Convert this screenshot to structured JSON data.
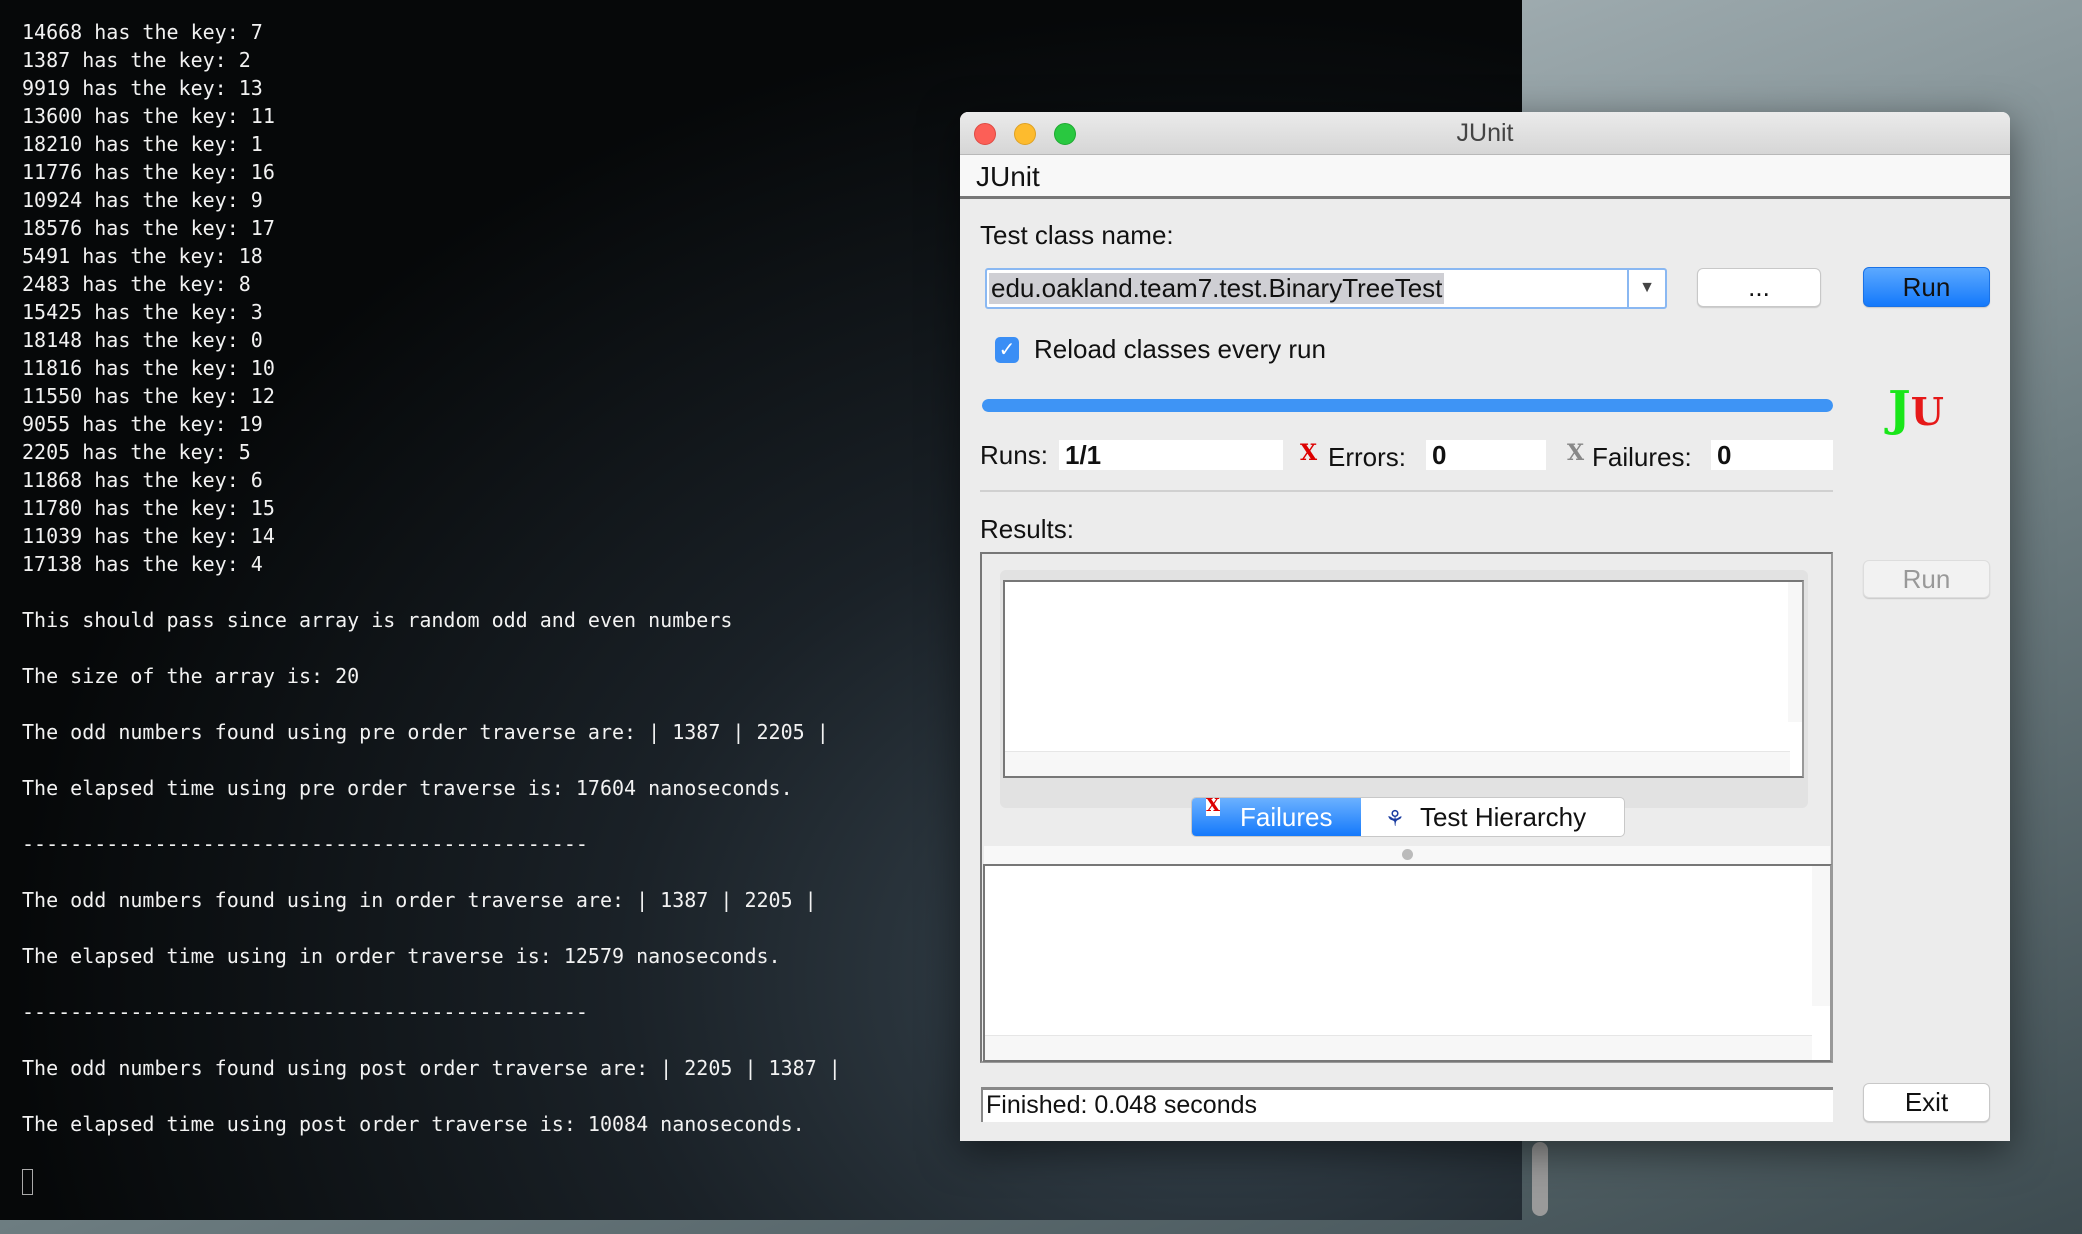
{
  "terminal": {
    "lines": [
      "14668 has the key: 7",
      "1387 has the key: 2",
      "9919 has the key: 13",
      "13600 has the key: 11",
      "18210 has the key: 1",
      "11776 has the key: 16",
      "10924 has the key: 9",
      "18576 has the key: 17",
      "5491 has the key: 18",
      "2483 has the key: 8",
      "15425 has the key: 3",
      "18148 has the key: 0",
      "11816 has the key: 10",
      "11550 has the key: 12",
      "9055 has the key: 19",
      "2205 has the key: 5",
      "11868 has the key: 6",
      "11780 has the key: 15",
      "11039 has the key: 14",
      "17138 has the key: 4",
      "",
      "This should pass since array is random odd and even numbers",
      "",
      "The size of the array is: 20",
      "",
      "The odd numbers found using pre order traverse are: | 1387 | 2205 |",
      "",
      "The elapsed time using pre order traverse is: 17604 nanoseconds.",
      "",
      "-----------------------------------------------",
      "",
      "The odd numbers found using in order traverse are: | 1387 | 2205 |",
      "",
      "The elapsed time using in order traverse is: 12579 nanoseconds.",
      "",
      "-----------------------------------------------",
      "",
      "The odd numbers found using post order traverse are: | 2205 | 1387 |",
      "",
      "The elapsed time using post order traverse is: 10084 nanoseconds.",
      ""
    ]
  },
  "window": {
    "title": "JUnit",
    "menu": "JUnit"
  },
  "form": {
    "test_class_label": "Test class name:",
    "test_class_value": "edu.oakland.team7.test.BinaryTreeTest",
    "browse_label": "...",
    "run_label": "Run",
    "reload_label": "Reload classes every run",
    "reload_checked": true,
    "progress": 1.0
  },
  "stats": {
    "runs_label": "Runs:",
    "runs_value": "1/1",
    "errors_label": "Errors:",
    "errors_value": "0",
    "failures_label": "Failures:",
    "failures_value": "0"
  },
  "results": {
    "label": "Results:",
    "run_label": "Run",
    "tabs": [
      {
        "label": "Failures",
        "active": true
      },
      {
        "label": "Test Hierarchy",
        "active": false
      }
    ]
  },
  "status": {
    "text": "Finished: 0.048 seconds",
    "exit_label": "Exit"
  },
  "colors": {
    "accent": "#1a82fb",
    "progress": "#3e94f5",
    "logo_j": "#19e619",
    "logo_u": "#e61919"
  }
}
